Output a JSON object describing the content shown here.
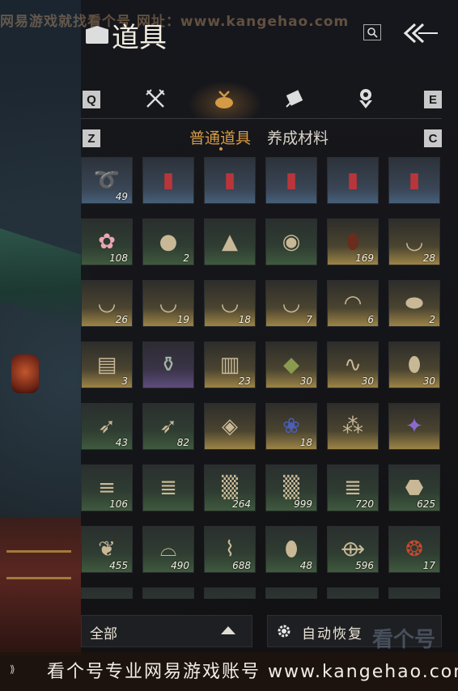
{
  "watermark_top": "网易游戏就找看个号 网址：www.kangehao.com",
  "header": {
    "title": "道具"
  },
  "category_keys": {
    "prev": "Q",
    "next": "E"
  },
  "categories": [
    {
      "icon": "crossed-swords-icon"
    },
    {
      "icon": "pouch-icon",
      "active": true
    },
    {
      "icon": "scroll-icon"
    },
    {
      "icon": "badge-icon"
    }
  ],
  "subtab_keys": {
    "prev": "Z",
    "next": "C"
  },
  "subtabs": [
    {
      "label": "普通道具",
      "active": true
    },
    {
      "label": "养成材料",
      "active": false
    }
  ],
  "items": [
    {
      "icon": "horn-icon",
      "count": "49",
      "rarity": "blue"
    },
    {
      "icon": "red-envelope-icon",
      "count": "",
      "rarity": "blue"
    },
    {
      "icon": "red-envelope-icon",
      "count": "",
      "rarity": "blue"
    },
    {
      "icon": "red-envelope-icon",
      "count": "",
      "rarity": "blue"
    },
    {
      "icon": "red-envelope-icon",
      "count": "",
      "rarity": "blue"
    },
    {
      "icon": "red-envelope-icon",
      "count": "",
      "rarity": "blue"
    },
    {
      "icon": "plum-blossom-icon",
      "count": "108",
      "rarity": "green"
    },
    {
      "icon": "flatbread-icon",
      "count": "2",
      "rarity": "green"
    },
    {
      "icon": "rock-tray-icon",
      "count": "",
      "rarity": "green"
    },
    {
      "icon": "lacquer-box-icon",
      "count": "",
      "rarity": "green"
    },
    {
      "icon": "wine-jar-icon",
      "count": "169",
      "rarity": "gold"
    },
    {
      "icon": "porcelain-bowl-icon",
      "count": "28",
      "rarity": "gold"
    },
    {
      "icon": "floral-bowl-icon",
      "count": "26",
      "rarity": "gold"
    },
    {
      "icon": "painted-bowl-icon",
      "count": "19",
      "rarity": "gold"
    },
    {
      "icon": "rooster-bowl-icon",
      "count": "18",
      "rarity": "gold"
    },
    {
      "icon": "ink-bowl-icon",
      "count": "7",
      "rarity": "gold"
    },
    {
      "icon": "covered-bowl-icon",
      "count": "6",
      "rarity": "gold"
    },
    {
      "icon": "plate-icon",
      "count": "2",
      "rarity": "gold"
    },
    {
      "icon": "chest-icon",
      "count": "3",
      "rarity": "gold"
    },
    {
      "icon": "vase-icon",
      "count": "",
      "rarity": "purple"
    },
    {
      "icon": "book-icon",
      "count": "23",
      "rarity": "gold"
    },
    {
      "icon": "herb-powder-icon",
      "count": "30",
      "rarity": "gold"
    },
    {
      "icon": "worm-icon",
      "count": "30",
      "rarity": "gold"
    },
    {
      "icon": "sack-icon",
      "count": "30",
      "rarity": "gold"
    },
    {
      "icon": "arrow-icon",
      "count": "43",
      "rarity": "green"
    },
    {
      "icon": "arrow-icon",
      "count": "82",
      "rarity": "green"
    },
    {
      "icon": "fish-stone-icon",
      "count": "",
      "rarity": "gold"
    },
    {
      "icon": "blue-flower-icon",
      "count": "18",
      "rarity": "gold"
    },
    {
      "icon": "insects-icon",
      "count": "",
      "rarity": "gold"
    },
    {
      "icon": "butterfly-icon",
      "count": "",
      "rarity": "gold"
    },
    {
      "icon": "bamboo-icon",
      "count": "106",
      "rarity": "green"
    },
    {
      "icon": "logs-icon",
      "count": "",
      "rarity": "green"
    },
    {
      "icon": "fiber-icon",
      "count": "264",
      "rarity": "green"
    },
    {
      "icon": "hay-icon",
      "count": "999",
      "rarity": "green"
    },
    {
      "icon": "timber-icon",
      "count": "720",
      "rarity": "green"
    },
    {
      "icon": "ore-icon",
      "count": "625",
      "rarity": "green"
    },
    {
      "icon": "feather-icon",
      "count": "455",
      "rarity": "green"
    },
    {
      "icon": "shells-icon",
      "count": "490",
      "rarity": "green"
    },
    {
      "icon": "shrimp-icon",
      "count": "688",
      "rarity": "green"
    },
    {
      "icon": "seed-bag-icon",
      "count": "48",
      "rarity": "green"
    },
    {
      "icon": "fish-icon",
      "count": "596",
      "rarity": "green"
    },
    {
      "icon": "berries-icon",
      "count": "17",
      "rarity": "green"
    },
    {
      "icon": "leaf-icon",
      "count": "",
      "rarity": "green"
    },
    {
      "icon": "clam-icon",
      "count": "",
      "rarity": "green"
    },
    {
      "icon": "unknown-icon",
      "count": "",
      "rarity": "green"
    },
    {
      "icon": "meat-icon",
      "count": "",
      "rarity": "green"
    },
    {
      "icon": "unknown-icon",
      "count": "",
      "rarity": "green"
    },
    {
      "icon": "jade-icon",
      "count": "",
      "rarity": "green"
    }
  ],
  "footer": {
    "filter_label": "全部",
    "auto_restore_label": "自动恢复"
  },
  "watermark_bottom": {
    "text": "看个号专业网易游戏账号 www.kangehao.com",
    "logo": "看个号"
  },
  "colors": {
    "accent": "#d59a45",
    "blue": "#46607a",
    "green": "#3f5a3d",
    "gold": "#9d8446",
    "purple": "#5e4c7c"
  }
}
